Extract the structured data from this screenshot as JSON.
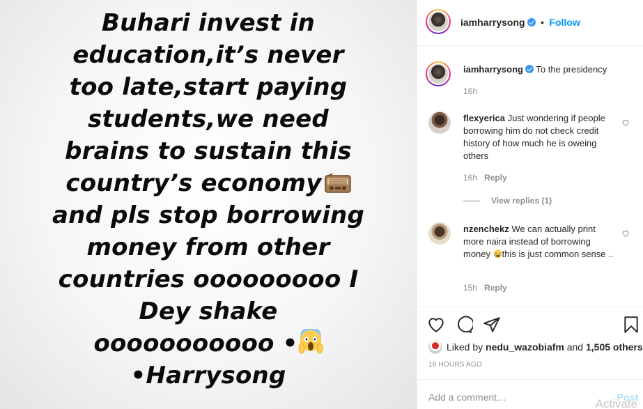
{
  "media": {
    "lines": [
      "Buhari invest in",
      "education,it’s never",
      "too late,start paying",
      "students,we need",
      "brains to sustain this",
      "country’s economy",
      "and pls stop borrowing",
      "money from other",
      "countries ooooooooo I",
      "Dey shake",
      "ooooooooooo •",
      "•Harrysong"
    ],
    "emoji_line6": "radio-emoji",
    "emoji_line11": "face-screaming-emoji"
  },
  "header": {
    "username": "iamharrysong",
    "separator": "•",
    "follow": "Follow"
  },
  "caption": {
    "username": "iamharrysong",
    "text": "To the presidency",
    "time": "16h"
  },
  "comments": [
    {
      "username": "flexyerica",
      "text": "Just wondering if people borrowing him do not check credit history of how much he is oweing others",
      "time": "16h",
      "reply": "Reply",
      "view_replies": "View replies (1)"
    },
    {
      "username": "nzenchekz",
      "text_before_emoji": "We can actually print more naira instead of borrowing money ",
      "text_after_emoji": "this is just common sense ..",
      "time": "15h",
      "reply": "Reply"
    }
  ],
  "likes": {
    "prefix": "Liked by ",
    "user": "nedu_wazobiafm",
    "middle": " and ",
    "count": "1,505 others"
  },
  "posted": "16 HOURS AGO",
  "add_comment": {
    "placeholder": "Add a comment…",
    "post": "Post"
  },
  "watermark": "Activate",
  "colors": {
    "accent": "#0095f6",
    "verified": "#3897f0",
    "muted": "#8e8e8e",
    "text": "#262626"
  }
}
